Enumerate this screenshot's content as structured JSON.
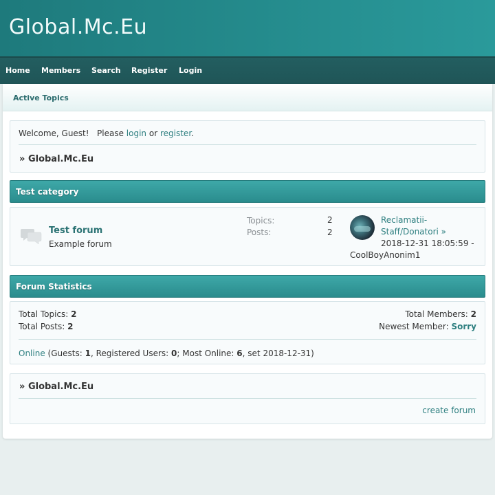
{
  "header": {
    "site_title": "Global.Mc.Eu"
  },
  "nav": {
    "items": [
      {
        "label": "Home"
      },
      {
        "label": "Members"
      },
      {
        "label": "Search"
      },
      {
        "label": "Register"
      },
      {
        "label": "Login"
      }
    ]
  },
  "subbar": {
    "active_topics": "Active Topics"
  },
  "welcome": {
    "prefix": "Welcome, Guest!   Please",
    "login": "login",
    "or": "or",
    "register": "register",
    "period": ".",
    "breadcrumb_marker": "»",
    "breadcrumb": "Global.Mc.Eu"
  },
  "category": {
    "title": "Test category",
    "forum": {
      "title": "Test forum",
      "description": "Example forum",
      "topics_label": "Topics:",
      "topics_value": "2",
      "posts_label": "Posts:",
      "posts_value": "2",
      "last_post": {
        "topic_line1": "Reclamatii-",
        "topic_line2": "Staff/Donatori",
        "arrow": "»",
        "datetime": "2018-12-31 18:05:59 -",
        "author": "CoolBoyAnonim1"
      }
    }
  },
  "stats": {
    "title": "Forum Statistics",
    "total_topics_label": "Total Topics:",
    "total_topics": "2",
    "total_posts_label": "Total Posts:",
    "total_posts": "2",
    "total_members_label": "Total Members:",
    "total_members": "2",
    "newest_member_label": "Newest Member:",
    "newest_member": "Sorry",
    "online_link": "Online",
    "guests_prefix": "(Guests:",
    "guests": "1",
    "registered_prefix": ", Registered Users:",
    "registered": "0",
    "most_online_prefix": "; Most Online:",
    "most_online": "6",
    "set_suffix": ", set 2018-12-31)"
  },
  "footer_box": {
    "breadcrumb_marker": "»",
    "breadcrumb": "Global.Mc.Eu",
    "create_forum": "create forum"
  },
  "colors": {
    "header_start": "#1e7a7c",
    "header_end": "#2a9a9b",
    "nav": "#235e60",
    "accent": "#2e7f80"
  }
}
